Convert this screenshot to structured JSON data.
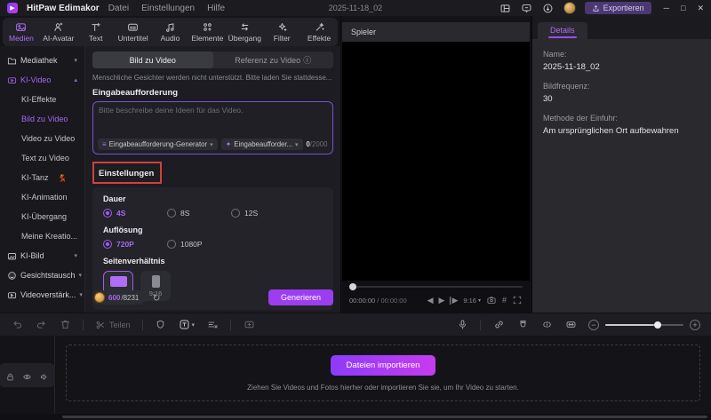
{
  "colors": {
    "accent": "#9C4DF4",
    "annotation_red": "#D2403C",
    "export_button": "#4B3873",
    "generate_button": "#9C3EF0"
  },
  "titlebar": {
    "app_name": "HitPaw Edimakor",
    "menu_items": [
      "Datei",
      "Einstellungen",
      "Hilfe"
    ],
    "project_title": "2025-11-18_02",
    "export_label": "Exportieren",
    "window_controls": {
      "minimize": "─",
      "maximize": "□",
      "close": "✕"
    }
  },
  "ribbon": {
    "tabs": [
      {
        "label": "Medien"
      },
      {
        "label": "AI-Avatar"
      },
      {
        "label": "Text"
      },
      {
        "label": "Untertitel"
      },
      {
        "label": "Audio"
      },
      {
        "label": "Elemente"
      },
      {
        "label": "Übergang"
      },
      {
        "label": "Filter"
      },
      {
        "label": "Effekte"
      }
    ]
  },
  "sidebar": {
    "items": [
      {
        "label": "Mediathek"
      },
      {
        "label": "KI-Video"
      },
      {
        "label": "KI-Effekte"
      },
      {
        "label": "Bild zu Video"
      },
      {
        "label": "Video zu Video"
      },
      {
        "label": "Text zu Video"
      },
      {
        "label": "KI-Tanz"
      },
      {
        "label": "KI-Animation"
      },
      {
        "label": "KI-Übergang"
      },
      {
        "label": "Meine Kreatio..."
      },
      {
        "label": "KI-Bild"
      },
      {
        "label": "Gesichtstausch"
      },
      {
        "label": "Videoverstärk..."
      }
    ]
  },
  "panel": {
    "mode_tabs": [
      "Bild zu Video",
      "Referenz zu Video"
    ],
    "notice": "Menschliche Gesichter werden nicht unterstützt. Bitte laden Sie stattdesse...",
    "prompt": {
      "label": "Eingabeaufforderung",
      "placeholder": "Bitte beschreibe deine Ideen für das Video.",
      "generator_chip": "Eingabeaufforderung-Generator",
      "optimizer_chip": "Eingabeaufforder...",
      "count_current": "0",
      "count_max": "/2000"
    },
    "settings": {
      "title": "Einstellungen",
      "duration_label": "Dauer",
      "duration_options": [
        "4S",
        "8S",
        "12S"
      ],
      "resolution_label": "Auflösung",
      "resolution_options": [
        "720P",
        "1080P"
      ],
      "aspect_label": "Seitenverhältnis",
      "aspect_options": [
        "16:9",
        "9:16"
      ]
    },
    "footer": {
      "credits_used": "600",
      "credits_total": "/8231",
      "generate_label": "Generieren"
    }
  },
  "player": {
    "title": "Spieler",
    "time_current": "00:00:00",
    "time_total": " / 00:00:00",
    "ratio": "9:16"
  },
  "details": {
    "tab_label": "Details",
    "name_label": "Name:",
    "name_value": "2025-11-18_02",
    "fps_label": "Bildfrequenz:",
    "fps_value": "30",
    "import_label": "Methode der Einfuhr:",
    "import_value": "Am ursprünglichen Ort aufbewahren"
  },
  "toolbar": {
    "split_label": "Teilen",
    "text_tool": "T"
  },
  "timeline": {
    "import_button": "Dateien importieren",
    "drop_hint": "Ziehen Sie Videos und Fotos hierher oder importieren Sie sie, um Ihr Video zu starten."
  },
  "icons": {
    "chevron_down": "▾",
    "chevron_up": "▴",
    "dropdown_caret": "▾",
    "info": "ⓘ",
    "refresh": "↻",
    "prev_frame": "◀",
    "play": "▶",
    "step_forward": "▶",
    "grid": "#",
    "zoom_out": "−",
    "zoom_in": "+",
    "generator_glyph": "≡",
    "optimizer_glyph": "✦",
    "dancer": "💃"
  }
}
